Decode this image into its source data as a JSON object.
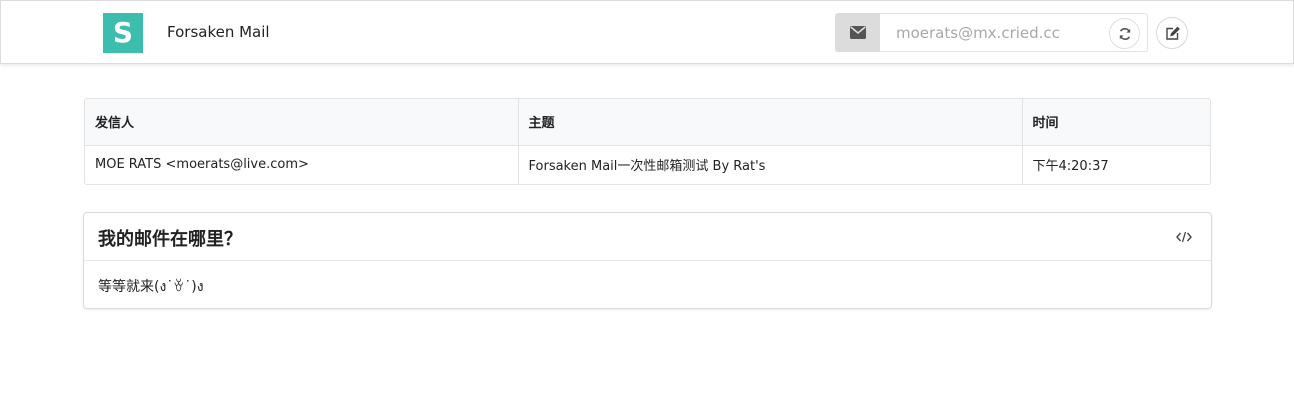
{
  "header": {
    "logo_letter": "S",
    "brand": "Forsaken Mail",
    "mail_address": "moerats@mx.cried.cc",
    "icons": {
      "mail": "envelope-icon",
      "refresh": "refresh-icon",
      "compose": "edit-icon"
    }
  },
  "inbox": {
    "columns": [
      "发信人",
      "主题",
      "时间"
    ],
    "rows": [
      {
        "from": "MOE RATS <moerats@live.com>",
        "subject": "Forsaken Mail一次性邮箱测试 By Rat's",
        "time": "下午4:20:37"
      }
    ]
  },
  "message_panel": {
    "title": "我的邮件在哪里？",
    "body": "等等就来(ง˙ꈊ˙)ง",
    "code_icon": "code-icon"
  },
  "colors": {
    "brand_teal": "#3dbdae",
    "addon_gray": "#dcdcdc"
  }
}
